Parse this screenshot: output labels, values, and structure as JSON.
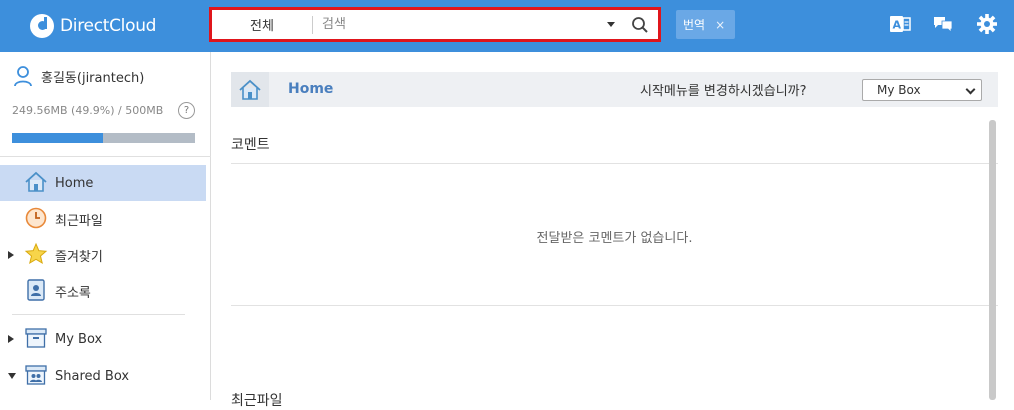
{
  "app": {
    "logo_text": "DirectCloud"
  },
  "search": {
    "scope": "전체",
    "placeholder": "검색"
  },
  "translate_chip": {
    "label": "번역",
    "close": "×"
  },
  "sidebar": {
    "user_name": "홍길동(jirantech)",
    "usage_text": "249.56MB (49.9%) / 500MB",
    "usage_fraction": 0.499,
    "help": "?",
    "items": [
      {
        "label": "Home",
        "icon": "home-icon",
        "active": true
      },
      {
        "label": "최근파일",
        "icon": "clock-icon"
      },
      {
        "label": "즐겨찾기",
        "icon": "star-icon"
      },
      {
        "label": "주소록",
        "icon": "address-book-icon"
      },
      {
        "label": "My Box",
        "icon": "box-icon"
      },
      {
        "label": "Shared Box",
        "icon": "shared-box-icon"
      }
    ]
  },
  "main": {
    "breadcrumb": "Home",
    "start_menu_question": "시작메뉴를 변경하시겠습니까?",
    "start_menu_selected": "My Box",
    "sections": [
      {
        "title": "코멘트",
        "empty_message": "전달받은 코멘트가 없습니다."
      },
      {
        "title": "최근파일"
      }
    ]
  },
  "colors": {
    "header": "#3d8fdc",
    "active_item": "#c9daf3",
    "highlight_border": "#e0151b"
  }
}
